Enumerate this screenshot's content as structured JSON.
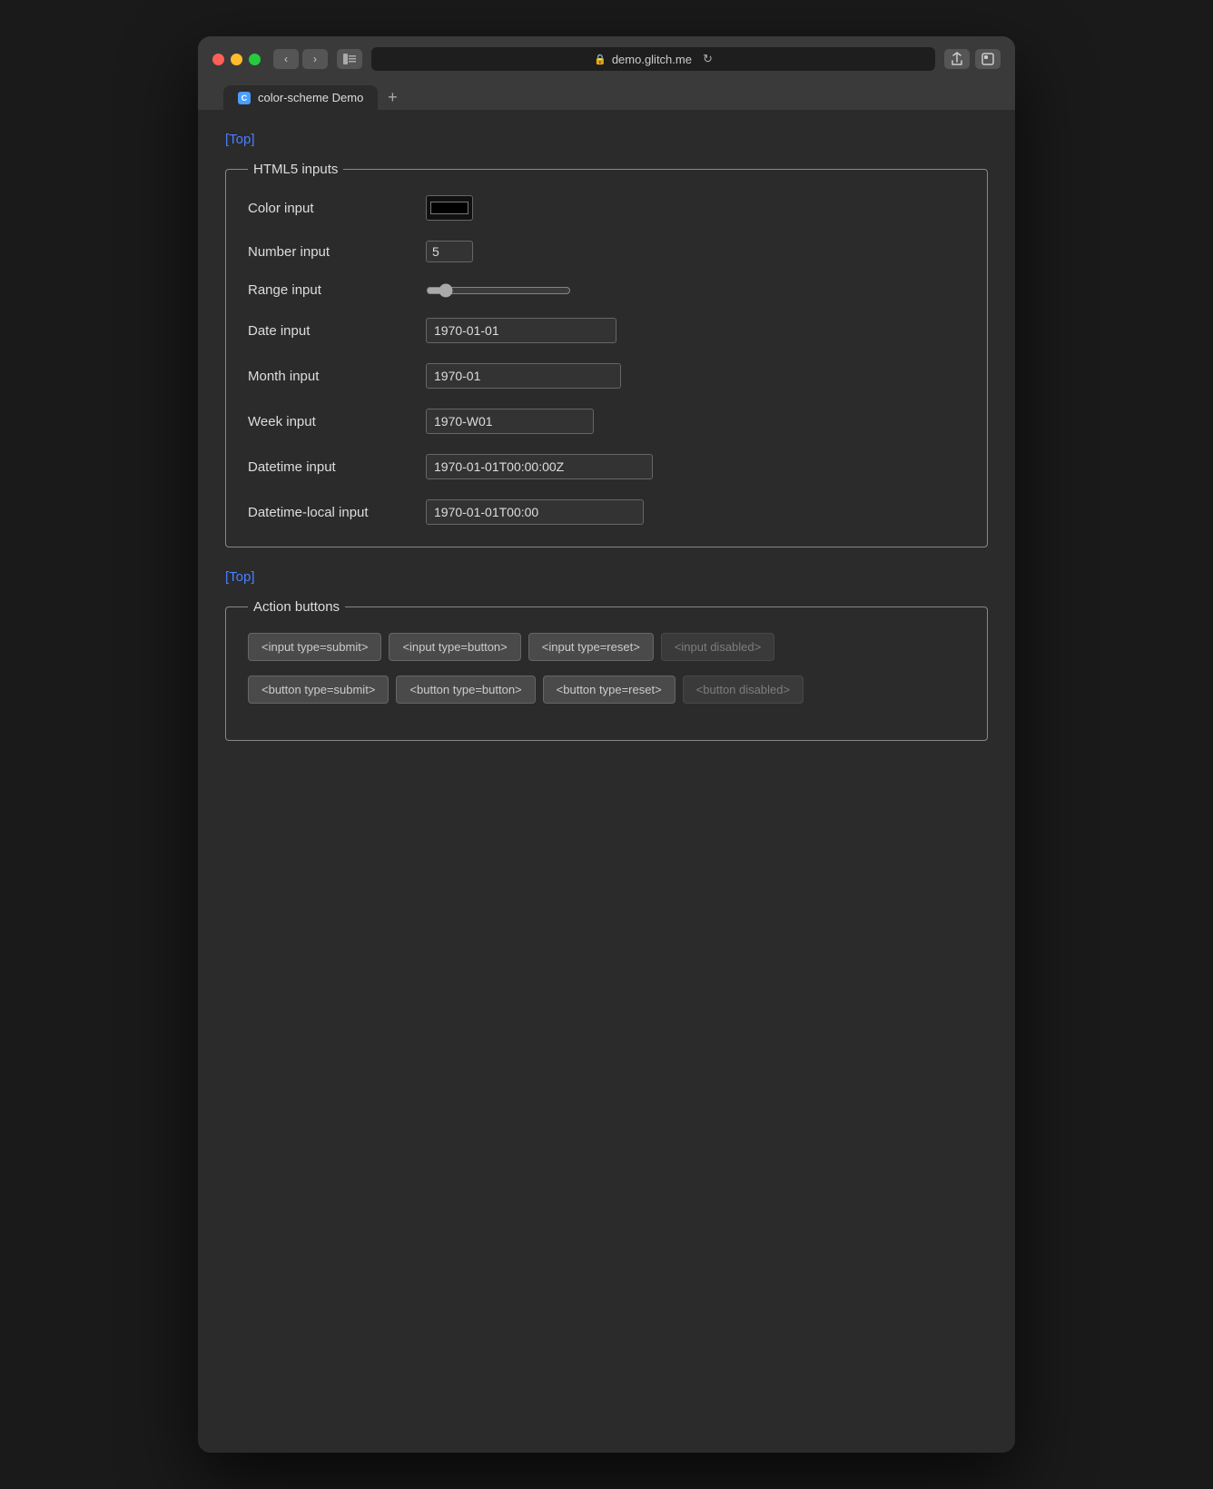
{
  "browser": {
    "url": "demo.glitch.me",
    "tab_title": "color-scheme Demo",
    "tab_favicon": "C",
    "reload_symbol": "↻"
  },
  "nav": {
    "back": "‹",
    "forward": "›",
    "new_tab": "+"
  },
  "page": {
    "top_link_1": "[Top]",
    "top_link_2": "[Top]",
    "html5_section_legend": "HTML5 inputs",
    "action_section_legend": "Action buttons",
    "inputs": {
      "color_label": "Color input",
      "color_value": "#000000",
      "number_label": "Number input",
      "number_value": "5",
      "range_label": "Range input",
      "date_label": "Date input",
      "date_value": "1970-01-01",
      "month_label": "Month input",
      "month_value": "1970-01",
      "week_label": "Week input",
      "week_value": "1970-W01",
      "datetime_label": "Datetime input",
      "datetime_value": "1970-01-01T00:00:00Z",
      "datetime_local_label": "Datetime-local input",
      "datetime_local_value": "1970-01-01T00:00"
    },
    "action_buttons": {
      "row1": [
        "<input type=submit>",
        "<input type=button>",
        "<input type=reset>"
      ],
      "row1_disabled": "<input disabled>",
      "row2": [
        "<button type=submit>",
        "<button type=button>",
        "<button type=reset>"
      ],
      "row2_disabled": "<button disabled>"
    }
  }
}
